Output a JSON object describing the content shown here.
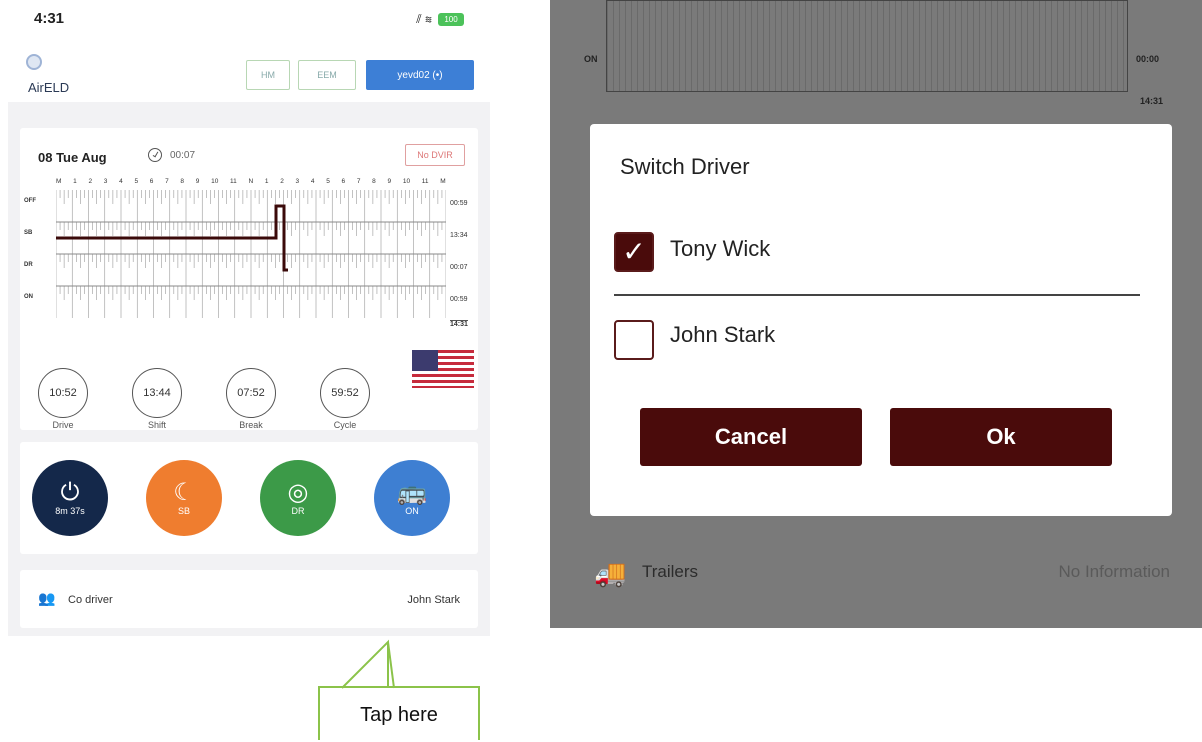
{
  "left": {
    "status_time": "4:31",
    "status_icons": "⫽ ≋",
    "battery": "100",
    "logo_text": "AirELD",
    "header_buttons": [
      "HM",
      "EEM",
      "yevd02"
    ],
    "header_button_icon": "(•)",
    "date": "08 Tue Aug",
    "clock_time": "00:07",
    "no_dvir": "No DVIR",
    "ticks": [
      "M",
      "1",
      "2",
      "3",
      "4",
      "5",
      "6",
      "7",
      "8",
      "9",
      "10",
      "11",
      "N",
      "1",
      "2",
      "3",
      "4",
      "5",
      "6",
      "7",
      "8",
      "9",
      "10",
      "11",
      "M"
    ],
    "rows": [
      {
        "label": "OFF",
        "time": "00:59"
      },
      {
        "label": "SB",
        "time": "13:34"
      },
      {
        "label": "DR",
        "time": "00:07"
      },
      {
        "label": "ON",
        "time": "00:59"
      }
    ],
    "total_time": "14:31",
    "timers": [
      {
        "value": "10:52",
        "label": "Drive"
      },
      {
        "value": "13:44",
        "label": "Shift"
      },
      {
        "value": "07:52",
        "label": "Break"
      },
      {
        "value": "59:52",
        "label": "Cycle"
      }
    ],
    "status_buttons": [
      {
        "label": "8m 37s",
        "color": "#14284a",
        "icon": "⏻"
      },
      {
        "label": "SB",
        "color": "#ef7d2f",
        "icon": "☾"
      },
      {
        "label": "DR",
        "color": "#3c9a48",
        "icon": "◎"
      },
      {
        "label": "ON",
        "color": "#3e7fd2",
        "icon": "🚌"
      }
    ],
    "co_driver_label": "Co driver",
    "co_driver_value": "John  Stark"
  },
  "callout": "Tap here",
  "right": {
    "grid_label": "ON",
    "grid_time1": "00:00",
    "grid_time2": "14:31",
    "dialog": {
      "title": "Switch Driver",
      "drivers": [
        {
          "name": "Tony  Wick",
          "checked": true
        },
        {
          "name": "John  Stark",
          "checked": false
        }
      ],
      "cancel": "Cancel",
      "ok": "Ok"
    },
    "trailers_label": "Trailers",
    "trailers_value": "No Information"
  },
  "colors": {
    "accent": "#4a0b0b",
    "callout_border": "#8bc34a"
  }
}
